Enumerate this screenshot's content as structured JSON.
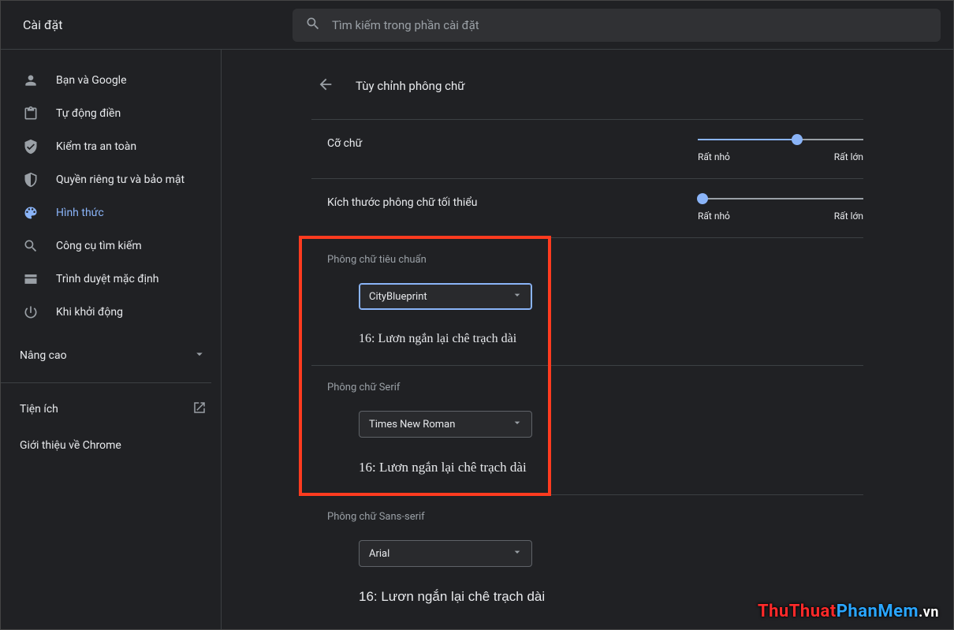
{
  "header": {
    "title": "Cài đặt",
    "search_placeholder": "Tìm kiếm trong phần cài đặt"
  },
  "sidebar": {
    "items": [
      {
        "label": "Bạn và Google"
      },
      {
        "label": "Tự động điền"
      },
      {
        "label": "Kiểm tra an toàn"
      },
      {
        "label": "Quyền riêng tư và bảo mật"
      },
      {
        "label": "Hình thức"
      },
      {
        "label": "Công cụ tìm kiếm"
      },
      {
        "label": "Trình duyệt mặc định"
      },
      {
        "label": "Khi khởi động"
      }
    ],
    "advanced": "Nâng cao",
    "extensions": "Tiện ích",
    "about": "Giới thiệu về Chrome"
  },
  "page": {
    "title": "Tùy chỉnh phông chữ",
    "slider1": {
      "label": "Cỡ chữ",
      "min": "Rất nhỏ",
      "max": "Rất lớn",
      "value_pct": 60
    },
    "slider2": {
      "label": "Kích thước phông chữ tối thiểu",
      "min": "Rất nhỏ",
      "max": "Rất lớn",
      "value_pct": 3
    },
    "groups": [
      {
        "title": "Phông chữ tiêu chuẩn",
        "selected": "CityBlueprint",
        "sample": "16: Lươn ngắn lại chê trạch dài"
      },
      {
        "title": "Phông chữ Serif",
        "selected": "Times New Roman",
        "sample": "16: Lươn ngắn lại chê trạch dài"
      },
      {
        "title": "Phông chữ Sans-serif",
        "selected": "Arial",
        "sample": "16: Lươn ngắn lại chê trạch dài"
      }
    ]
  },
  "watermark": {
    "a": "ThuThuat",
    "b": "PhanMem",
    "c": ".vn"
  }
}
